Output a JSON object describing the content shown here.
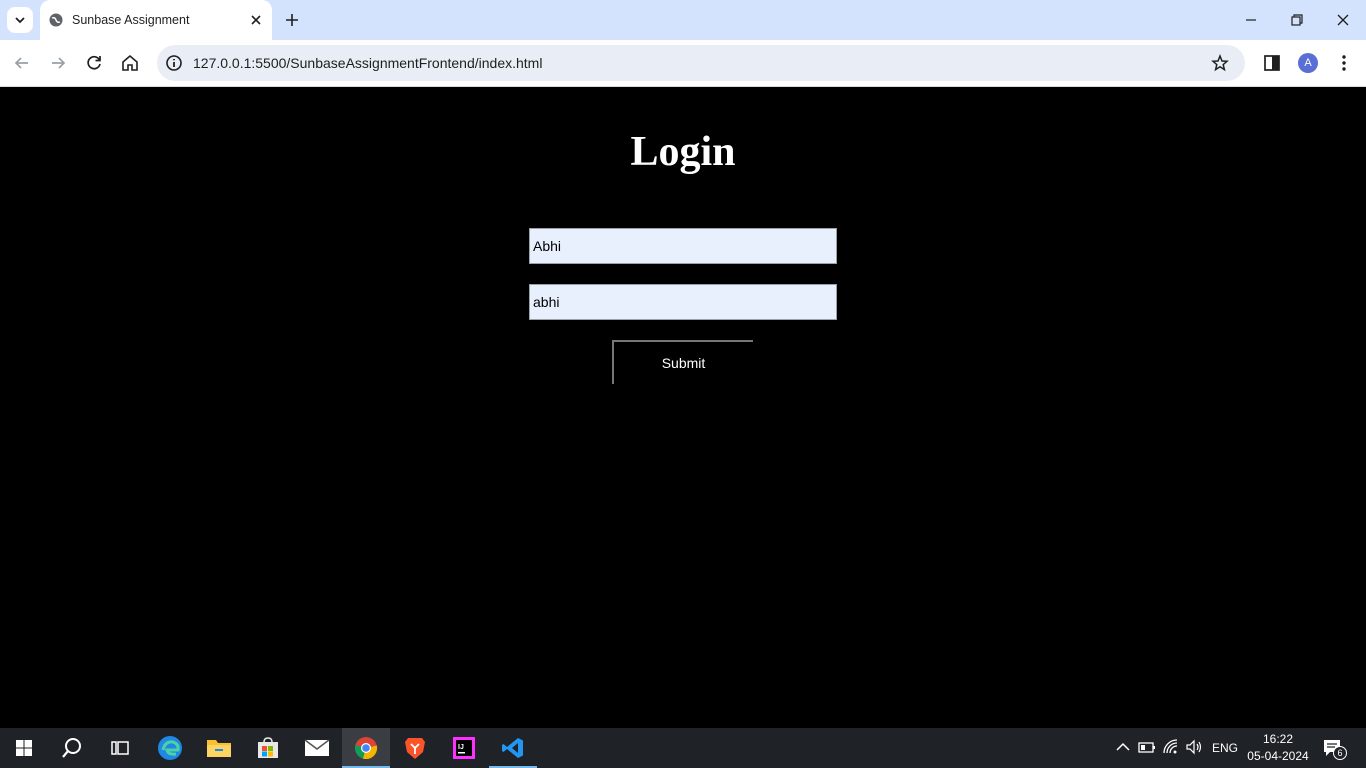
{
  "browser": {
    "tab_title": "Sunbase Assignment",
    "url": "127.0.0.1:5500/SunbaseAssignmentFrontend/index.html",
    "profile_initial": "A"
  },
  "page": {
    "title": "Login",
    "username_value": "Abhi",
    "password_value": "abhi",
    "submit_label": "Submit"
  },
  "taskbar": {
    "language": "ENG",
    "time": "16:22",
    "date": "05-04-2024",
    "notification_count": "6"
  },
  "colors": {
    "tabstrip_bg": "#d3e3fd",
    "page_bg": "#000000",
    "input_bg": "#e8f0fe",
    "taskbar_bg": "#1f2226"
  }
}
